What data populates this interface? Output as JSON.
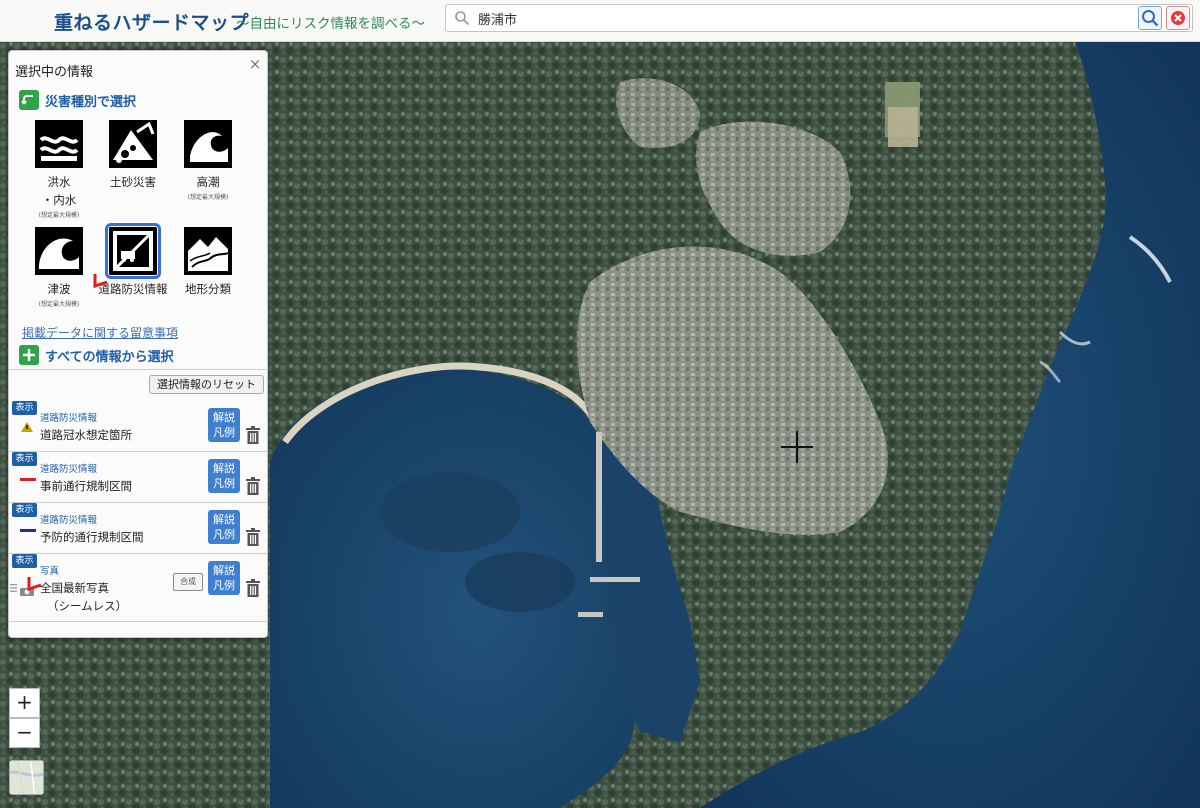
{
  "header": {
    "title": "重ねるハザードマップ",
    "subtitle": "～自由にリスク情報を調べる～",
    "search_value": "勝浦市"
  },
  "panel": {
    "title": "選択中の情報",
    "close_label": "×",
    "section_disaster": "災害種別で選択",
    "section_all": "すべての情報から選択",
    "notice_link": "掲載データに関する留意事項",
    "reset_label": "選択情報のリセット"
  },
  "hazards": [
    {
      "label1": "洪水",
      "label2": "・内水",
      "note": "(想定最大規模)",
      "icon": "flood-icon"
    },
    {
      "label1": "土砂災害",
      "label2": "",
      "note": "",
      "icon": "landslide-icon"
    },
    {
      "label1": "高潮",
      "label2": "",
      "note": "(想定最大規模)",
      "icon": "storm-surge-icon"
    },
    {
      "label1": "津波",
      "label2": "",
      "note": "(想定最大規模)",
      "icon": "tsunami-icon"
    },
    {
      "label1": "道路防災情報",
      "label2": "",
      "note": "",
      "icon": "road-disaster-icon",
      "selected": true
    },
    {
      "label1": "地形分類",
      "label2": "",
      "note": "",
      "icon": "terrain-icon"
    }
  ],
  "layers": [
    {
      "badge": "表示",
      "category": "道路防災情報",
      "name": "道路冠水想定箇所",
      "legend": "warning-triangle",
      "explain": [
        "解説",
        "凡例"
      ]
    },
    {
      "badge": "表示",
      "category": "道路防災情報",
      "name": "事前通行規制区間",
      "legend": "red-line",
      "legend_color": "#e02020",
      "explain": [
        "解説",
        "凡例"
      ]
    },
    {
      "badge": "表示",
      "category": "道路防災情報",
      "name": "予防的通行規制区間",
      "legend": "blue-line",
      "legend_color": "#1a2fa8",
      "explain": [
        "解説",
        "凡例"
      ]
    },
    {
      "badge": "表示",
      "category": "写真",
      "name": "全国最新写真",
      "name2": "（シームレス）",
      "compose": "合成",
      "explain": [
        "解説",
        "凡例"
      ]
    }
  ],
  "map_controls": {
    "zoom_in": "+",
    "zoom_out": "−"
  },
  "colors": {
    "title_blue": "#1a4f8b",
    "subtitle_green": "#2e8b57",
    "accent_blue": "#3f7fd0",
    "section_green": "#2fa34a"
  }
}
